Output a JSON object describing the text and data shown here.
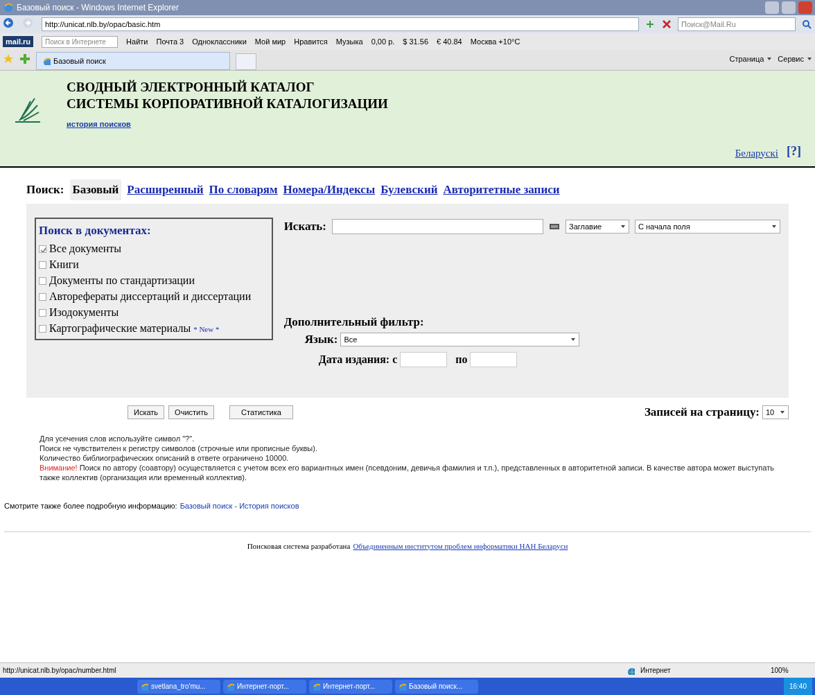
{
  "window": {
    "title": "Базовый поиск - Windows Internet Explorer"
  },
  "address_bar": {
    "url": "http://unicat.nlb.by/opac/basic.htm",
    "search_placeholder": "Поиск@Mail.Ru"
  },
  "toolbar": {
    "logo": "mail.ru",
    "search_placeholder": "Поиск в Интернете",
    "find": "Найти",
    "items": [
      "Почта 3",
      "Одноклассники",
      "Мой мир",
      "Нравится",
      "Музыка",
      "0,00 р.",
      "$ 31.56",
      "€ 40.84",
      "Москва +10°C"
    ]
  },
  "tab": {
    "title": "Базовый поиск"
  },
  "command_bar": [
    "Страница",
    "Сервис"
  ],
  "header": {
    "title_lines": [
      "СВОДНЫЙ ЭЛЕКТРОННЫЙ КАТАЛОГ",
      "СИСТЕМЫ КОРПОРАТИВНОЙ КАТАЛОГИЗАЦИИ"
    ],
    "history_link": "история поисков",
    "language_link": "Беларускі",
    "help": "[?]"
  },
  "search_nav": {
    "label": "Поиск:",
    "items": [
      {
        "label": "Базовый",
        "selected": true
      },
      {
        "label": "Расширенный",
        "selected": false
      },
      {
        "label": "По словарям",
        "selected": false
      },
      {
        "label": "Номера/Индексы",
        "selected": false
      },
      {
        "label": "Булевский",
        "selected": false
      },
      {
        "label": "Авторитетные записи",
        "selected": false
      }
    ]
  },
  "doc_filter": {
    "title": "Поиск в документах:",
    "items": [
      {
        "label": "Все документы",
        "checked": true
      },
      {
        "label": "Книги",
        "checked": false
      },
      {
        "label": "Документы по стандартизации",
        "checked": false
      },
      {
        "label": "Авторефераты диссертаций и диссертации",
        "checked": false
      },
      {
        "label": "Изодокументы",
        "checked": false
      },
      {
        "label": "Картографические материалы",
        "checked": false,
        "badge": "* New *"
      }
    ]
  },
  "search": {
    "label": "Искать:",
    "field": "Заглавие",
    "mode": "С начала поля"
  },
  "extra_filter": {
    "title": "Дополнительный фильтр:",
    "language_label": "Язык:",
    "language": "Все",
    "date_label": "Дата издания: с",
    "date_to": "по"
  },
  "buttons": [
    "Искать",
    "Очистить",
    "Статистика"
  ],
  "per_page": {
    "label": "Записей на страницу:",
    "value": "10"
  },
  "notes": [
    "Для усечения слов используйте символ \"?\".",
    "Поиск не чувствителен к регистру символов (строчные или прописные буквы).",
    "Количество библиографических описаний в ответе ограничено 10000."
  ],
  "warning": {
    "label": "Внимание!",
    "text": "Поиск по автору (соавтору) осуществляется с учетом всех его вариантных имен (псевдоним, девичья фамилия и т.п.), представленных в авторитетной записи. В качестве автора может выступать также коллектив (организация или временный коллектив)."
  },
  "see_also": {
    "text": "Смотрите также более подробную информацию:",
    "link": "Базовый поиск - История поисков"
  },
  "footer": {
    "text": "Поисковая система разработана",
    "link": "Объединенным институтом проблем информатики НАН Беларуси"
  },
  "status_bar": {
    "url": "http://unicat.nlb.by/opac/number.html",
    "zone": "Интернет",
    "zoom": "100%"
  },
  "taskbar": {
    "items": [
      "svetlana_tro'mu...",
      "Интернет-порт...",
      "Интернет-порт...",
      "Базовый поиск..."
    ],
    "clock": "16:40"
  }
}
